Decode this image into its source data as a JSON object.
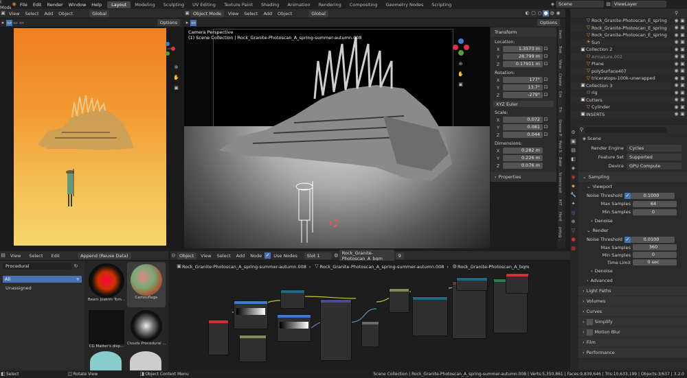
{
  "topbar": {
    "mode_fragment": "t Mode",
    "menus": [
      "File",
      "Edit",
      "Render",
      "Window",
      "Help"
    ],
    "workspaces": [
      "Layout",
      "Modeling",
      "Sculpting",
      "UV Editing",
      "Texture Paint",
      "Shading",
      "Animation",
      "Rendering",
      "Compositing",
      "Geometry Nodes",
      "Scripting"
    ],
    "active_workspace": "Layout",
    "scene": "Scene",
    "view_layer": "ViewLayer"
  },
  "left_editor": {
    "header": {
      "menus": [
        "View",
        "Select",
        "Add",
        "Object"
      ],
      "transform_orientation": "Global"
    },
    "options": "Options"
  },
  "center_viewport": {
    "header": {
      "mode": "Object Mode",
      "menus": [
        "View",
        "Select",
        "Add",
        "Object"
      ],
      "transform_orientation": "Global"
    },
    "options": "Options",
    "camera_label": "Camera Perspective",
    "collection_label": "(1) Scene Collection | Rock_Granite-Photoscan_A_spring-summer-autumn.008"
  },
  "npanel": {
    "transform_title": "Transform",
    "location_label": "Location:",
    "loc_x": "1.3573 m",
    "loc_y": "28.799 m",
    "loc_z": "0.17911 m",
    "rotation_label": "Rotation:",
    "rot_x": "177°",
    "rot_y": "13.7°",
    "rot_z": "-279°",
    "rot_mode": "XYZ Euler",
    "scale_label": "Scale:",
    "scale_x": "0.072",
    "scale_y": "0.081",
    "scale_z": "0.044",
    "dimensions_label": "Dimensions:",
    "dim_x": "0.282 m",
    "dim_y": "0.226 m",
    "dim_z": "0.076 m",
    "properties_title": "Properties",
    "axes": [
      "X",
      "Y",
      "Z"
    ]
  },
  "side_tabs": [
    "Item",
    "Tool",
    "View",
    "Create",
    "Cre",
    "Tls",
    "Grease P.",
    "Real S",
    "Bake",
    "Screencast",
    "KIT",
    "Hard",
    "polyg"
  ],
  "outliner": {
    "items": [
      {
        "name": "Rock_Granite-Photoscan_E_spring-s..."
      },
      {
        "name": "Rock_Granite-Photoscan_E_spring-s..."
      },
      {
        "name": "Rock_Granite-Photoscan_E_spring-s..."
      },
      {
        "name": "Sun"
      },
      {
        "name": "Collection 2"
      },
      {
        "name": "Armature.002"
      },
      {
        "name": "Plane"
      },
      {
        "name": "polySurface407"
      },
      {
        "name": "triceratops-100k-unwrapped"
      },
      {
        "name": "Collection 3"
      },
      {
        "name": "rig"
      },
      {
        "name": "Cutters"
      },
      {
        "name": "Cylinder"
      },
      {
        "name": "INSERTS"
      }
    ]
  },
  "properties": {
    "scene_name": "Scene",
    "render_engine_label": "Render Engine",
    "render_engine": "Cycles",
    "feature_set_label": "Feature Set",
    "feature_set": "Supported",
    "device_label": "Device",
    "device": "GPU Compute",
    "sampling": "Sampling",
    "viewport": "Viewport",
    "noise_threshold_label": "Noise Threshold",
    "vp_noise": "0.1000",
    "max_samples_label": "Max Samples",
    "vp_max": "64",
    "min_samples_label": "Min Samples",
    "vp_min": "0",
    "denoise": "Denoise",
    "render": "Render",
    "r_noise": "0.0100",
    "r_max": "360",
    "r_min": "0",
    "time_limit_label": "Time Limit",
    "r_time": "0 sec",
    "denoise2": "Denoise",
    "advanced": "Advanced",
    "light_paths": "Light Paths",
    "volumes": "Volumes",
    "curves": "Curves",
    "simplify": "Simplify",
    "motion_blur": "Motion Blur",
    "film": "Film",
    "performance": "Performance"
  },
  "asset_browser": {
    "menus": [
      "View",
      "Select",
      "Edit"
    ],
    "import_mode": "Append (Reuse Data)",
    "library": "Procedural",
    "catalogs": [
      "All",
      "Unassigned"
    ],
    "assets": [
      "Beam Joakim Tom...",
      "Camouflage",
      "CG Matter's disp...",
      "Clouds Procedural ..."
    ]
  },
  "node_editor": {
    "header": {
      "mode": "Object",
      "menus": [
        "View",
        "Select",
        "Add",
        "Node"
      ],
      "use_nodes": "Use Nodes",
      "slot": "Slot 1",
      "material": "Rock_Granite-Photoscan_A_bqm",
      "users": "9"
    },
    "breadcrumb": [
      "Rock_Granite-Photoscan_A_spring-summer-autumn.008",
      "Rock_Granite-Photoscan_A_spring-summer-autumn.008",
      "Rock_Granite-Photoscan_A_bqm"
    ]
  },
  "statusbar": {
    "select": "Select",
    "rotate": "Rotate View",
    "context": "Object Context Menu",
    "stats": "Scene Collection | Rock_Granite-Photoscan_A_spring-summer-autumn.008 | Verts:5,350,861 | Faces:9,839,646 | Tris:10,633,199 | Objects:3/637 | 3.2.0"
  },
  "colors": {
    "accent": "#4772b3",
    "active_tab": "#474747",
    "desert_top": "#f28a2a",
    "desert_bottom": "#f3c75a",
    "node_yellow": "#c7c729"
  }
}
